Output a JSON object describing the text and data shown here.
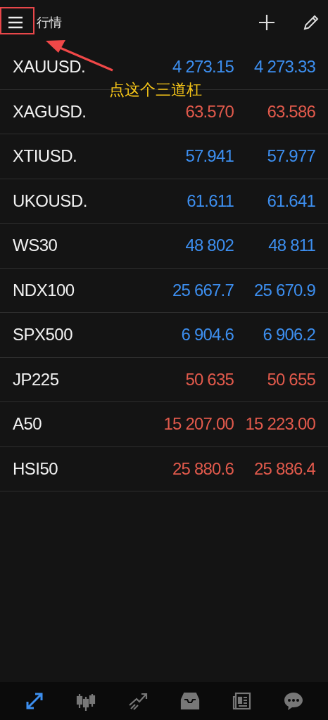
{
  "header": {
    "title": "行情"
  },
  "quotes": [
    {
      "symbol": "XAUUSD.",
      "bid": "4 273.15",
      "ask": "4 273.33",
      "color": "#3d8ff0"
    },
    {
      "symbol": "XAGUSD.",
      "bid": "63.570",
      "ask": "63.586",
      "color": "#e25a4c"
    },
    {
      "symbol": "XTIUSD.",
      "bid": "57.941",
      "ask": "57.977",
      "color": "#3d8ff0"
    },
    {
      "symbol": "UKOUSD.",
      "bid": "61.611",
      "ask": "61.641",
      "color": "#3d8ff0"
    },
    {
      "symbol": "WS30",
      "bid": "48 802",
      "ask": "48 811",
      "color": "#3d8ff0"
    },
    {
      "symbol": "NDX100",
      "bid": "25 667.7",
      "ask": "25 670.9",
      "color": "#3d8ff0"
    },
    {
      "symbol": "SPX500",
      "bid": "6 904.6",
      "ask": "6 906.2",
      "color": "#3d8ff0"
    },
    {
      "symbol": "JP225",
      "bid": "50 635",
      "ask": "50 655",
      "color": "#e25a4c"
    },
    {
      "symbol": "A50",
      "bid": "15 207.00",
      "ask": "15 223.00",
      "color": "#e25a4c"
    },
    {
      "symbol": "HSI50",
      "bid": "25 880.6",
      "ask": "25 886.4",
      "color": "#e25a4c"
    }
  ],
  "bottom_nav": [
    {
      "kind": "quotes",
      "selected": true
    },
    {
      "kind": "chart",
      "selected": false
    },
    {
      "kind": "trade",
      "selected": false
    },
    {
      "kind": "history",
      "selected": false
    },
    {
      "kind": "news",
      "selected": false
    },
    {
      "kind": "chat",
      "selected": false
    }
  ],
  "annotation": {
    "text": "点这个三道杠"
  }
}
